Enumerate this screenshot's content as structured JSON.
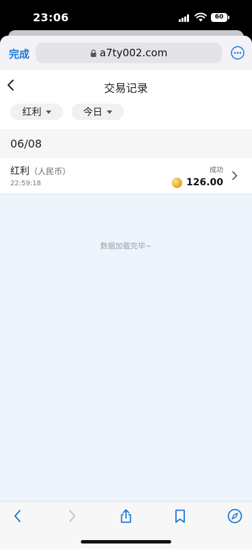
{
  "status_bar": {
    "time": "23:06",
    "battery": "60"
  },
  "browser": {
    "done_label": "完成",
    "url": "a7ty002.com"
  },
  "page": {
    "title": "交易记录",
    "filters": [
      {
        "label": "红利"
      },
      {
        "label": "今日"
      }
    ],
    "date_group": "06/08",
    "records": [
      {
        "type": "红利",
        "currency": "（人民币）",
        "time": "22:59:18",
        "status": "成功",
        "amount": "126.00"
      }
    ],
    "end_message": "数据加载完毕~"
  },
  "colors": {
    "accent": "#1a78d6",
    "coin": "#e4ad26",
    "background": "#eef4fc"
  },
  "icons": [
    "back-icon",
    "lock-icon",
    "more-icon",
    "chevron-right-icon",
    "coin-icon",
    "share-icon",
    "bookmark-icon",
    "compass-icon"
  ]
}
